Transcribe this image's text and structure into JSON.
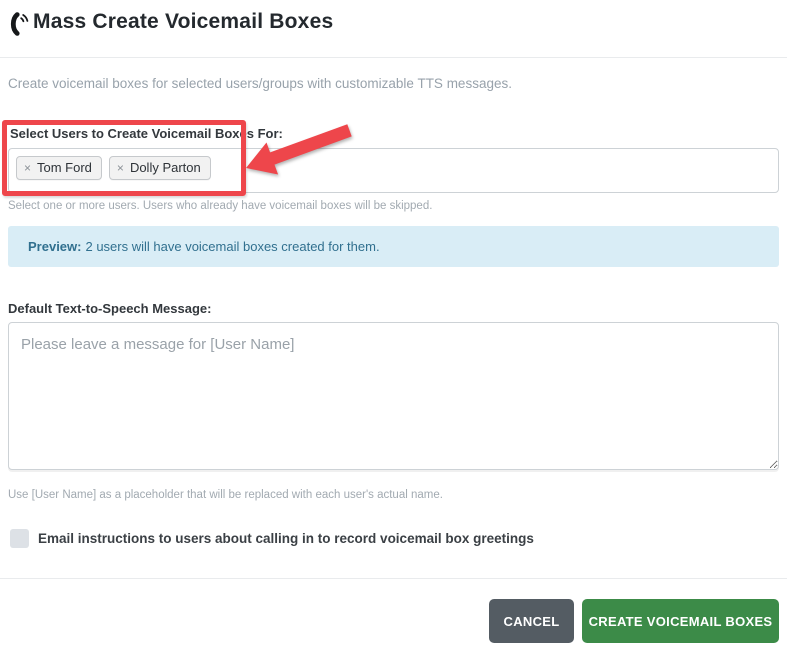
{
  "header": {
    "title": "Mass Create Voicemail Boxes",
    "icon": "phone-volume-icon"
  },
  "intro": {
    "description": "Create voicemail boxes for selected users/groups with customizable TTS messages."
  },
  "user_select": {
    "label": "Select Users to Create Voicemail Boxes For:",
    "tags": [
      {
        "remove_glyph": "×",
        "name": "Tom Ford"
      },
      {
        "remove_glyph": "×",
        "name": "Dolly Parton"
      }
    ],
    "helper": "Select one or more users. Users who already have voicemail boxes will be skipped."
  },
  "preview_banner": {
    "label": "Preview:",
    "message": "2 users will have voicemail boxes created for them."
  },
  "tts_message": {
    "label": "Default Text-to-Speech Message:",
    "placeholder": "Please leave a message for [User Name]",
    "value": "",
    "helper": "Use [User Name] as a placeholder that will be replaced with each user's actual name."
  },
  "email_option": {
    "checked": false,
    "label": "Email instructions to users about calling in to record voicemail box greetings"
  },
  "actions": {
    "cancel_label": "CANCEL",
    "create_label": "CREATE VOICEMAIL BOXES"
  },
  "annotations": {
    "highlight_box": "red-rectangle-around-user-select",
    "arrow": "red-arrow-pointing-at-user-select"
  },
  "colors": {
    "annotation_red": "#ee464b",
    "preview_bg": "#d9edf6",
    "preview_text": "#31708f",
    "cancel_bg": "#545c63",
    "create_bg": "#3c8b48",
    "tag_bg": "#f2f2f2"
  }
}
